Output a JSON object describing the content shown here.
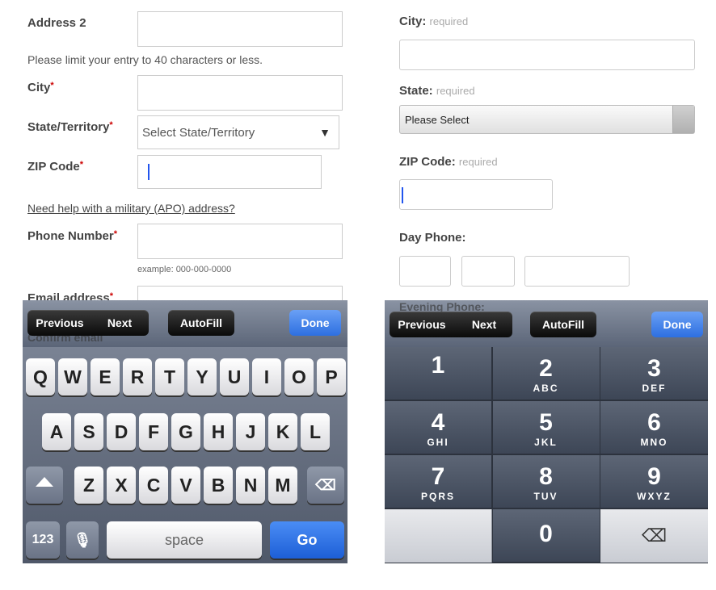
{
  "left": {
    "address2_label": "Address 2",
    "address2_hint": "Please limit your entry to 40 characters or less.",
    "city_label": "City",
    "state_label": "State/Territory",
    "state_placeholder": "Select State/Territory",
    "zip_label": "ZIP Code",
    "military_link": "Need help with a military (APO) address?",
    "phone_label": "Phone Number",
    "phone_example": "example: 000-000-0000",
    "email_label": "Email address",
    "confirm_label": "Confirm email",
    "required_mark": "*",
    "toolbar": {
      "previous": "Previous",
      "next": "Next",
      "autofill": "AutoFill",
      "done": "Done"
    },
    "keys_row1": [
      "Q",
      "W",
      "E",
      "R",
      "T",
      "Y",
      "U",
      "I",
      "O",
      "P"
    ],
    "keys_row2": [
      "A",
      "S",
      "D",
      "F",
      "G",
      "H",
      "J",
      "K",
      "L"
    ],
    "keys_row3": [
      "Z",
      "X",
      "C",
      "V",
      "B",
      "N",
      "M"
    ],
    "key_123": "123",
    "key_space": "space",
    "key_go": "Go"
  },
  "right": {
    "city_label": "City:",
    "state_label": "State:",
    "zip_label": "ZIP Code:",
    "required_text": "required",
    "state_value": "Please Select",
    "day_phone_label": "Day Phone:",
    "evening_phone_label": "Evening Phone:",
    "toolbar": {
      "previous": "Previous",
      "next": "Next",
      "autofill": "AutoFill",
      "done": "Done"
    },
    "numpad": [
      {
        "digit": "1",
        "letters": ""
      },
      {
        "digit": "2",
        "letters": "ABC"
      },
      {
        "digit": "3",
        "letters": "DEF"
      },
      {
        "digit": "4",
        "letters": "GHI"
      },
      {
        "digit": "5",
        "letters": "JKL"
      },
      {
        "digit": "6",
        "letters": "MNO"
      },
      {
        "digit": "7",
        "letters": "PQRS"
      },
      {
        "digit": "8",
        "letters": "TUV"
      },
      {
        "digit": "9",
        "letters": "WXYZ"
      },
      {
        "digit": "0",
        "letters": ""
      }
    ]
  },
  "colors": {
    "accent_blue": "#2d6fe0",
    "required_red": "#cc0000"
  }
}
